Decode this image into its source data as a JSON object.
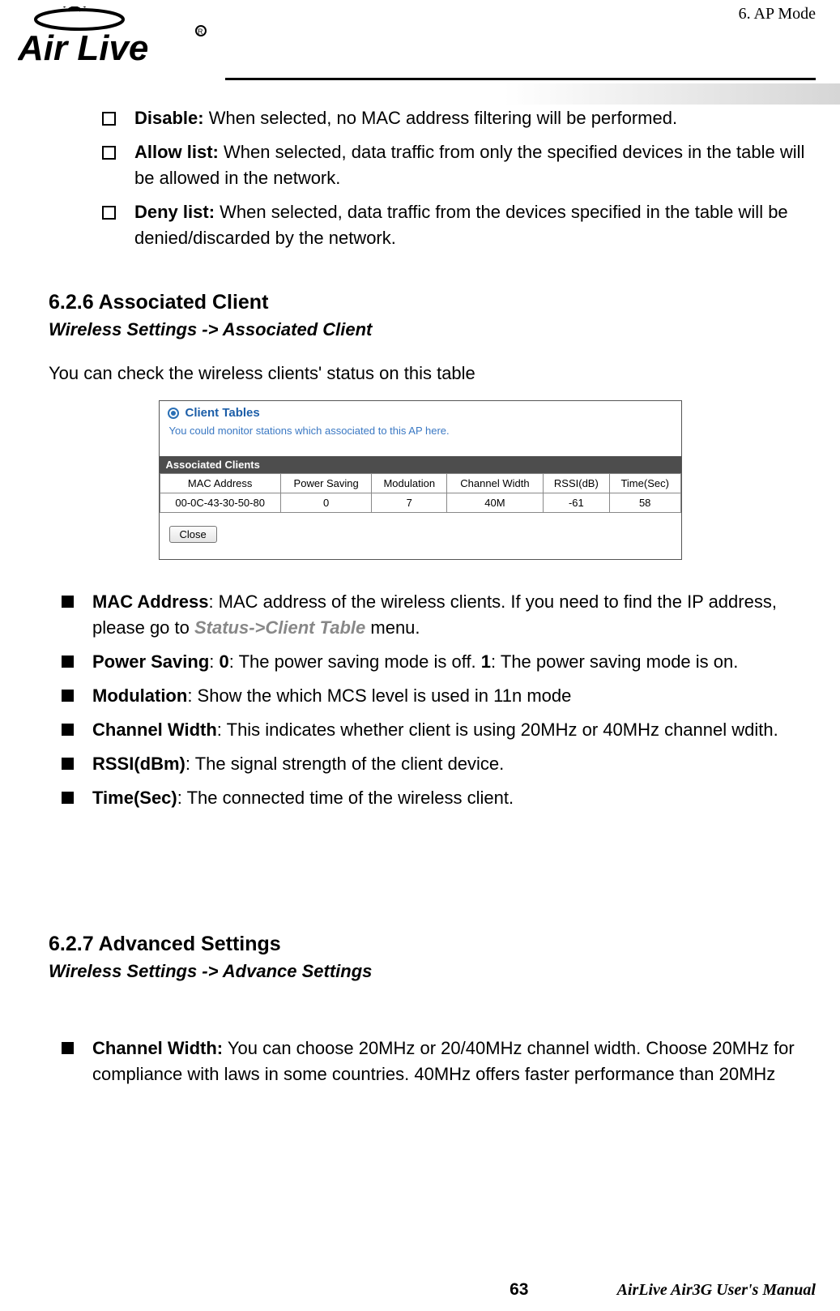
{
  "header": {
    "chapter": "6.    AP  Mode",
    "logo_alt": "Air Live"
  },
  "list1": [
    {
      "label": "Disable:",
      "text": " When selected, no MAC address filtering will be performed."
    },
    {
      "label": "Allow list:",
      "text": " When selected, data traffic from only the specified devices in the table will be allowed in the network."
    },
    {
      "label": "Deny list:",
      "text": " When selected, data traffic from the devices specified in the table will be denied/discarded by the network."
    }
  ],
  "section626": {
    "heading": "6.2.6 Associated Client",
    "breadcrumb": "Wireless Settings -> Associated Client",
    "intro": "You can check the wireless clients' status on this table"
  },
  "screenshot": {
    "title": "Client Tables",
    "desc": "You could monitor stations which associated to this AP here.",
    "subhead": "Associated Clients",
    "columns": [
      "MAC Address",
      "Power Saving",
      "Modulation",
      "Channel Width",
      "RSSI(dB)",
      "Time(Sec)"
    ],
    "row": [
      "00-0C-43-30-50-80",
      "0",
      "7",
      "40M",
      "-61",
      "58"
    ],
    "close": "Close"
  },
  "assoc_params": {
    "mac": {
      "label": "MAC Address",
      "text": ":    MAC address of the wireless clients.    If you need to find the IP address, please go to ",
      "menu": "Status->Client Table",
      "tail": " menu."
    },
    "power": {
      "label": "Power Saving",
      "text": ":    ",
      "b0": "0",
      "t0": ": The power saving mode is off.    ",
      "b1": "1",
      "t1": ": The power saving mode is on."
    },
    "mod": {
      "label": "Modulation",
      "text": ":    Show the which MCS level is used in 11n mode"
    },
    "cw": {
      "label": "Channel Width",
      "text": ":    This indicates whether client is using 20MHz or 40MHz channel wdith."
    },
    "rssi": {
      "label": "RSSI(dBm)",
      "text": ":    The signal strength of the client device."
    },
    "time": {
      "label": "Time(Sec)",
      "text": ":    The connected time of the wireless client."
    }
  },
  "section627": {
    "heading": "6.2.7 Advanced Settings",
    "breadcrumb": "Wireless Settings -> Advance Settings"
  },
  "adv_params": {
    "cw": {
      "label": "Channel Width:",
      "text": "    You can choose 20MHz or 20/40MHz channel width.    Choose 20MHz for compliance with laws in some countries.    40MHz offers faster performance than 20MHz"
    }
  },
  "footer": {
    "page": "63",
    "right": "AirLive  Air3G  User's  Manual"
  }
}
